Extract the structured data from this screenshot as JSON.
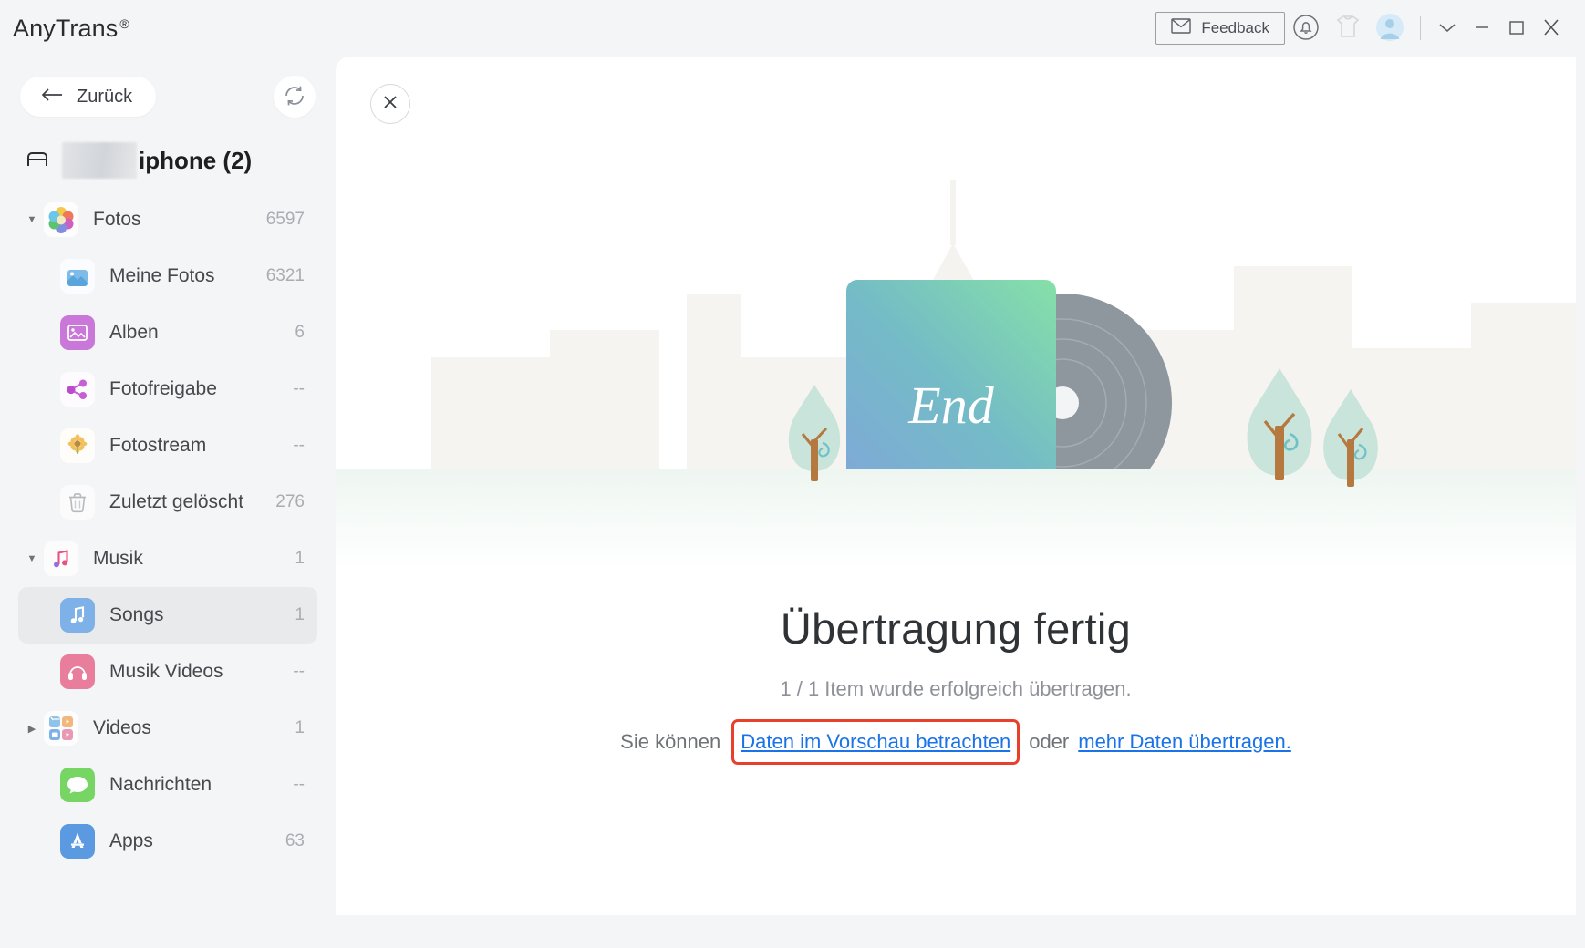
{
  "app": {
    "brand": "AnyTrans",
    "registered_mark": "®"
  },
  "titlebar": {
    "feedback_label": "Feedback",
    "icons": {
      "envelope": "envelope-icon",
      "bell": "bell-icon",
      "tshirt": "tshirt-icon",
      "avatar": "avatar-icon",
      "chevron_down": "chevron-down-icon",
      "minimize": "minimize-icon",
      "maximize": "maximize-icon",
      "close": "close-icon"
    }
  },
  "sidebar": {
    "back_label": "Zurück",
    "refresh_label": "refresh-icon",
    "device": {
      "name_suffix": "iphone (2)",
      "redacted": true
    },
    "items": [
      {
        "label": "Fotos",
        "count": "6597",
        "level": "parent",
        "expanded": true,
        "icon": "photos-icon",
        "selected": false
      },
      {
        "label": "Meine Fotos",
        "count": "6321",
        "level": "child",
        "expanded": false,
        "icon": "my-photos-icon",
        "selected": false
      },
      {
        "label": "Alben",
        "count": "6",
        "level": "child",
        "expanded": false,
        "icon": "albums-icon",
        "selected": false
      },
      {
        "label": "Fotofreigabe",
        "count": "--",
        "level": "child",
        "expanded": false,
        "icon": "photo-share-icon",
        "selected": false
      },
      {
        "label": "Fotostream",
        "count": "--",
        "level": "child",
        "expanded": false,
        "icon": "photostream-icon",
        "selected": false
      },
      {
        "label": "Zuletzt gelöscht",
        "count": "276",
        "level": "child",
        "expanded": false,
        "icon": "trash-icon",
        "selected": false
      },
      {
        "label": "Musik",
        "count": "1",
        "level": "parent",
        "expanded": true,
        "icon": "music-icon",
        "selected": false
      },
      {
        "label": "Songs",
        "count": "1",
        "level": "child",
        "expanded": false,
        "icon": "songs-icon",
        "selected": true
      },
      {
        "label": "Musik Videos",
        "count": "--",
        "level": "child",
        "expanded": false,
        "icon": "music-video-icon",
        "selected": false
      },
      {
        "label": "Videos",
        "count": "1",
        "level": "parent",
        "expanded": false,
        "icon": "videos-icon",
        "selected": false
      },
      {
        "label": "Nachrichten",
        "count": "--",
        "level": "child",
        "expanded": false,
        "icon": "messages-icon",
        "selected": false
      },
      {
        "label": "Apps",
        "count": "63",
        "level": "child",
        "expanded": false,
        "icon": "apps-icon",
        "selected": false
      }
    ]
  },
  "main": {
    "close_label": "close-panel-icon",
    "album_cover_text": "End",
    "heading": "Übertragung fertig",
    "subtitle": "1 / 1 Item wurde erfolgreich übertragen.",
    "links_line": {
      "prefix": "Sie können",
      "link_primary": "Daten im Vorschau betrachten",
      "middle": "oder",
      "link_secondary": "mehr Daten übertragen."
    }
  },
  "colors": {
    "link": "#1a73e8",
    "highlight_box": "#e8402a",
    "sidebar_bg": "#f4f5f7",
    "panel_bg": "#ffffff",
    "selected_row": "#e9eaec",
    "album_gradient_from": "#7fa8d8",
    "album_gradient_to": "#86e0a8",
    "tree_green": "#bfe0d4"
  }
}
